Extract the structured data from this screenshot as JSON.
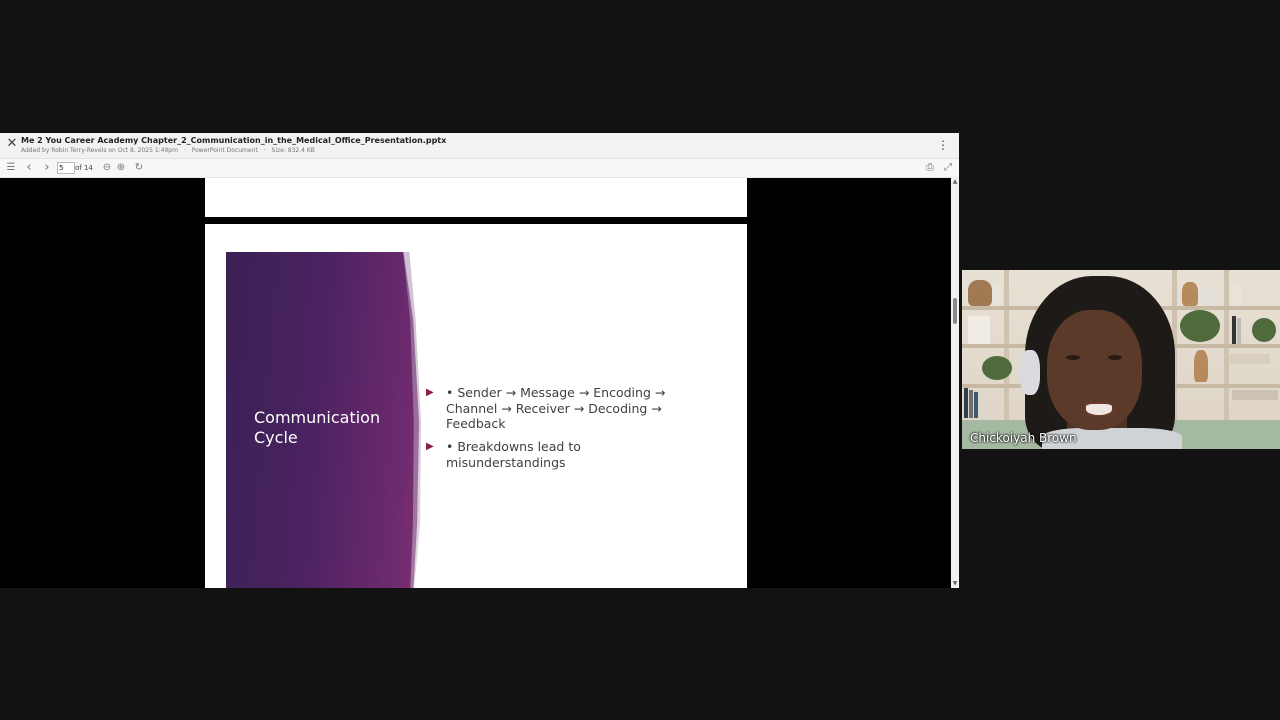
{
  "viewer": {
    "title": "Me 2 You Career Academy Chapter_2_Communication_in_the_Medical_Office_Presentation.pptx",
    "added_by": "Added by Robin Terry-Revels on Oct 8, 2025 1:49pm",
    "doc_type": "PowerPoint Document",
    "size": "Size: 832.4 KB",
    "separator": "·",
    "close_glyph": "✕",
    "menu_glyph": "⋮"
  },
  "toolbar": {
    "sidebar_icon": "☰",
    "prev_icon": "‹",
    "next_icon": "›",
    "page_current": "5",
    "page_of": "of 14",
    "zoom_out_icon": "⊖",
    "zoom_in_icon": "⊕",
    "rotate_icon": "↻",
    "print_icon": "⎙",
    "fullscreen_icon": "⤢"
  },
  "slide": {
    "title": "Communication Cycle",
    "bullets": [
      "• Sender → Message → Encoding → Channel → Receiver → Decoding → Feedback",
      "• Breakdowns lead to misunderstandings"
    ],
    "bullet_marker": "▶",
    "accent_color": "#5a2566",
    "marker_color": "#8b1c4a"
  },
  "scrollbar": {
    "up_arrow": "▲",
    "down_arrow": "▼"
  },
  "participant": {
    "name": "Chickoiyah Brown"
  }
}
